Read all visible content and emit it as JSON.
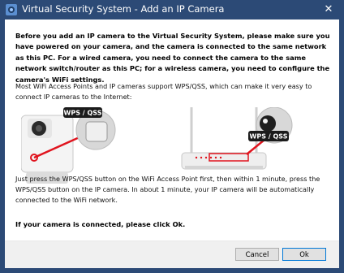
{
  "window": {
    "title": "Virtual Security System - Add an IP Camera",
    "close_glyph": "✕"
  },
  "content": {
    "intro_bold": "Before you add an IP camera to the Virtual Security System, please make sure you have powered on your camera, and the camera is connected to the same network as this PC. For a wired camera, you need to connect the camera to the same network switch/router as this PC; for a wireless camera, you need to configure the camera's WiFi settings.",
    "intro_normal": "Most WiFi Access Points and IP cameras support WPS/QSS, which can make it very easy to connect IP cameras to the Internet:",
    "illustration": {
      "camera_label": "WPS / QSS",
      "router_label": "WPS / QSS",
      "accent_color": "#e0141e"
    },
    "instructions": "Just press the WPS/QSS button on the WiFi Access Point first, then within 1 minute, press the WPS/QSS button on the IP camera.  In about 1 minute, your IP camera will be automatically connected to the WiFi network.",
    "connected_note": "If your camera is connected, please click Ok."
  },
  "buttons": {
    "cancel": "Cancel",
    "ok": "Ok"
  },
  "colors": {
    "titlebar": "#2c4a76",
    "ok_border": "#0078d7"
  }
}
